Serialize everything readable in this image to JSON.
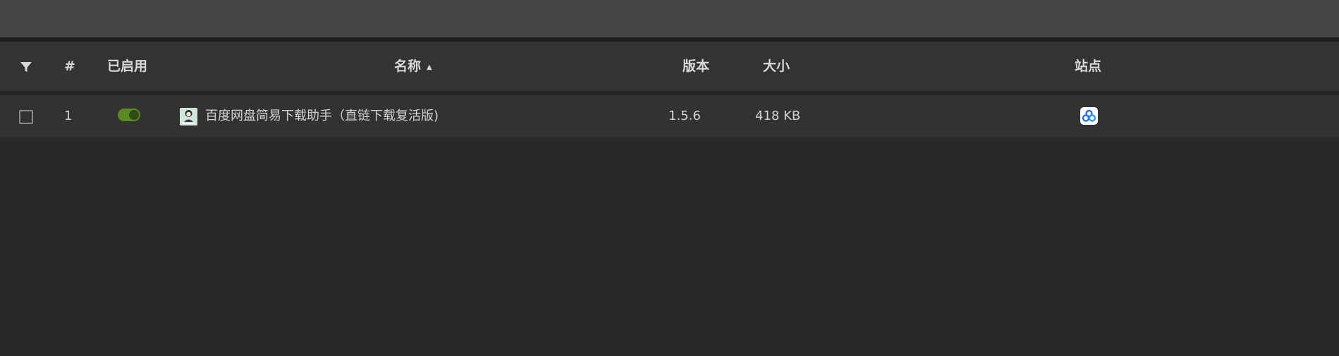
{
  "table": {
    "headers": {
      "index": "#",
      "enabled": "已启用",
      "name": "名称",
      "version": "版本",
      "size": "大小",
      "sites": "站点"
    },
    "sort_indicator": "▲",
    "rows": [
      {
        "index": "1",
        "enabled": true,
        "icon": "script-avatar-icon",
        "name": "百度网盘简易下载助手（直链下载复活版)",
        "version": "1.5.6",
        "size": "418 KB",
        "site_icon": "baidu-netdisk-icon"
      }
    ]
  },
  "colors": {
    "background": "#292929",
    "toolbar": "#454545",
    "header_row": "#333333",
    "data_row": "#323232",
    "toggle_on": "#5b8a24",
    "site_icon_blue": "#2b6de8"
  }
}
